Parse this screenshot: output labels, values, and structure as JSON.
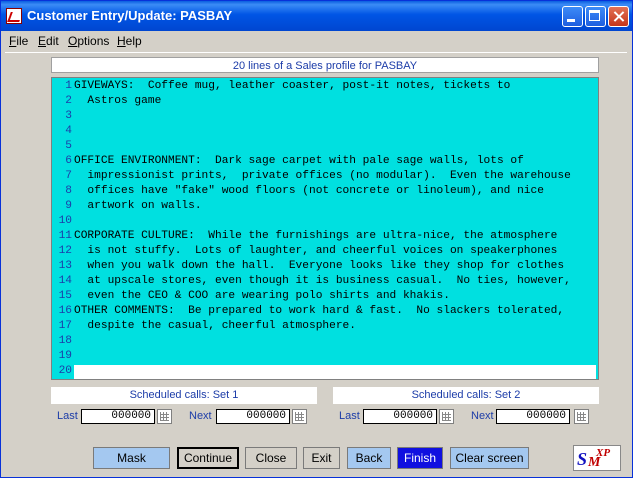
{
  "window": {
    "title": "Customer Entry/Update:  PASBAY"
  },
  "menu": [
    "File",
    "Edit",
    "Options",
    "Help"
  ],
  "profile": {
    "header": "20 lines of a Sales profile for PASBAY",
    "lines": [
      "GIVEWAYS:  Coffee mug, leather coaster, post-it notes, tickets to",
      "  Astros game",
      "",
      "",
      "",
      "OFFICE ENVIRONMENT:  Dark sage carpet with pale sage walls, lots of",
      "  impressionist prints,  private offices (no modular).  Even the warehouse",
      "  offices have \"fake\" wood floors (not concrete or linoleum), and nice",
      "  artwork on walls.",
      "",
      "CORPORATE CULTURE:  While the furnishings are ultra-nice, the atmosphere",
      "  is not stuffy.  Lots of laughter, and cheerful voices on speakerphones",
      "  when you walk down the hall.  Everyone looks like they shop for clothes",
      "  at upscale stores, even though it is business casual.  No ties, however,",
      "  even the CEO & COO are wearing polo shirts and khakis.",
      "OTHER COMMENTS:  Be prepared to work hard & fast.  No slackers tolerated,",
      "  despite the casual, cheerful atmosphere.",
      "",
      "",
      ""
    ]
  },
  "scheduled": {
    "set1": {
      "title": "Scheduled calls: Set 1",
      "last_label": "Last",
      "last_value": "000000",
      "next_label": "Next",
      "next_value": "000000"
    },
    "set2": {
      "title": "Scheduled calls: Set 2",
      "last_label": "Last",
      "last_value": "000000",
      "next_label": "Next",
      "next_value": "000000"
    }
  },
  "buttons": {
    "mask": "Mask",
    "continue": "Continue",
    "close": "Close",
    "exit": "Exit",
    "back": "Back",
    "finish": "Finish",
    "clear": "Clear screen"
  },
  "logo": {
    "s": "S",
    "m": "M",
    "xp": "XP"
  },
  "colors": {
    "editor_bg": "#00E0E0",
    "label_blue": "#1C3CA8",
    "finish_bg": "#1010E0"
  }
}
